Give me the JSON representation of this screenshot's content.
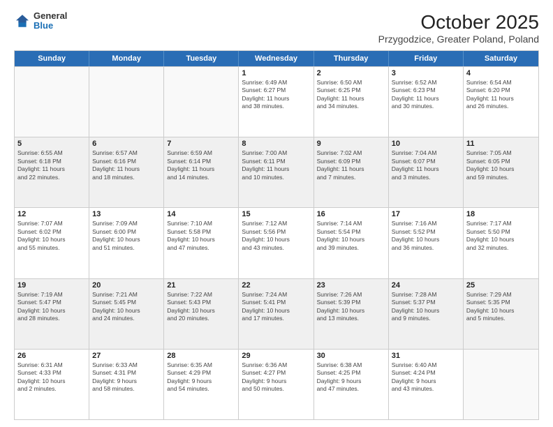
{
  "logo": {
    "general": "General",
    "blue": "Blue"
  },
  "title": "October 2025",
  "location": "Przygodzice, Greater Poland, Poland",
  "header_days": [
    "Sunday",
    "Monday",
    "Tuesday",
    "Wednesday",
    "Thursday",
    "Friday",
    "Saturday"
  ],
  "rows": [
    [
      {
        "date": "",
        "info": ""
      },
      {
        "date": "",
        "info": ""
      },
      {
        "date": "",
        "info": ""
      },
      {
        "date": "1",
        "info": "Sunrise: 6:49 AM\nSunset: 6:27 PM\nDaylight: 11 hours\nand 38 minutes."
      },
      {
        "date": "2",
        "info": "Sunrise: 6:50 AM\nSunset: 6:25 PM\nDaylight: 11 hours\nand 34 minutes."
      },
      {
        "date": "3",
        "info": "Sunrise: 6:52 AM\nSunset: 6:23 PM\nDaylight: 11 hours\nand 30 minutes."
      },
      {
        "date": "4",
        "info": "Sunrise: 6:54 AM\nSunset: 6:20 PM\nDaylight: 11 hours\nand 26 minutes."
      }
    ],
    [
      {
        "date": "5",
        "info": "Sunrise: 6:55 AM\nSunset: 6:18 PM\nDaylight: 11 hours\nand 22 minutes."
      },
      {
        "date": "6",
        "info": "Sunrise: 6:57 AM\nSunset: 6:16 PM\nDaylight: 11 hours\nand 18 minutes."
      },
      {
        "date": "7",
        "info": "Sunrise: 6:59 AM\nSunset: 6:14 PM\nDaylight: 11 hours\nand 14 minutes."
      },
      {
        "date": "8",
        "info": "Sunrise: 7:00 AM\nSunset: 6:11 PM\nDaylight: 11 hours\nand 10 minutes."
      },
      {
        "date": "9",
        "info": "Sunrise: 7:02 AM\nSunset: 6:09 PM\nDaylight: 11 hours\nand 7 minutes."
      },
      {
        "date": "10",
        "info": "Sunrise: 7:04 AM\nSunset: 6:07 PM\nDaylight: 11 hours\nand 3 minutes."
      },
      {
        "date": "11",
        "info": "Sunrise: 7:05 AM\nSunset: 6:05 PM\nDaylight: 10 hours\nand 59 minutes."
      }
    ],
    [
      {
        "date": "12",
        "info": "Sunrise: 7:07 AM\nSunset: 6:02 PM\nDaylight: 10 hours\nand 55 minutes."
      },
      {
        "date": "13",
        "info": "Sunrise: 7:09 AM\nSunset: 6:00 PM\nDaylight: 10 hours\nand 51 minutes."
      },
      {
        "date": "14",
        "info": "Sunrise: 7:10 AM\nSunset: 5:58 PM\nDaylight: 10 hours\nand 47 minutes."
      },
      {
        "date": "15",
        "info": "Sunrise: 7:12 AM\nSunset: 5:56 PM\nDaylight: 10 hours\nand 43 minutes."
      },
      {
        "date": "16",
        "info": "Sunrise: 7:14 AM\nSunset: 5:54 PM\nDaylight: 10 hours\nand 39 minutes."
      },
      {
        "date": "17",
        "info": "Sunrise: 7:16 AM\nSunset: 5:52 PM\nDaylight: 10 hours\nand 36 minutes."
      },
      {
        "date": "18",
        "info": "Sunrise: 7:17 AM\nSunset: 5:50 PM\nDaylight: 10 hours\nand 32 minutes."
      }
    ],
    [
      {
        "date": "19",
        "info": "Sunrise: 7:19 AM\nSunset: 5:47 PM\nDaylight: 10 hours\nand 28 minutes."
      },
      {
        "date": "20",
        "info": "Sunrise: 7:21 AM\nSunset: 5:45 PM\nDaylight: 10 hours\nand 24 minutes."
      },
      {
        "date": "21",
        "info": "Sunrise: 7:22 AM\nSunset: 5:43 PM\nDaylight: 10 hours\nand 20 minutes."
      },
      {
        "date": "22",
        "info": "Sunrise: 7:24 AM\nSunset: 5:41 PM\nDaylight: 10 hours\nand 17 minutes."
      },
      {
        "date": "23",
        "info": "Sunrise: 7:26 AM\nSunset: 5:39 PM\nDaylight: 10 hours\nand 13 minutes."
      },
      {
        "date": "24",
        "info": "Sunrise: 7:28 AM\nSunset: 5:37 PM\nDaylight: 10 hours\nand 9 minutes."
      },
      {
        "date": "25",
        "info": "Sunrise: 7:29 AM\nSunset: 5:35 PM\nDaylight: 10 hours\nand 5 minutes."
      }
    ],
    [
      {
        "date": "26",
        "info": "Sunrise: 6:31 AM\nSunset: 4:33 PM\nDaylight: 10 hours\nand 2 minutes."
      },
      {
        "date": "27",
        "info": "Sunrise: 6:33 AM\nSunset: 4:31 PM\nDaylight: 9 hours\nand 58 minutes."
      },
      {
        "date": "28",
        "info": "Sunrise: 6:35 AM\nSunset: 4:29 PM\nDaylight: 9 hours\nand 54 minutes."
      },
      {
        "date": "29",
        "info": "Sunrise: 6:36 AM\nSunset: 4:27 PM\nDaylight: 9 hours\nand 50 minutes."
      },
      {
        "date": "30",
        "info": "Sunrise: 6:38 AM\nSunset: 4:25 PM\nDaylight: 9 hours\nand 47 minutes."
      },
      {
        "date": "31",
        "info": "Sunrise: 6:40 AM\nSunset: 4:24 PM\nDaylight: 9 hours\nand 43 minutes."
      },
      {
        "date": "",
        "info": ""
      }
    ]
  ]
}
